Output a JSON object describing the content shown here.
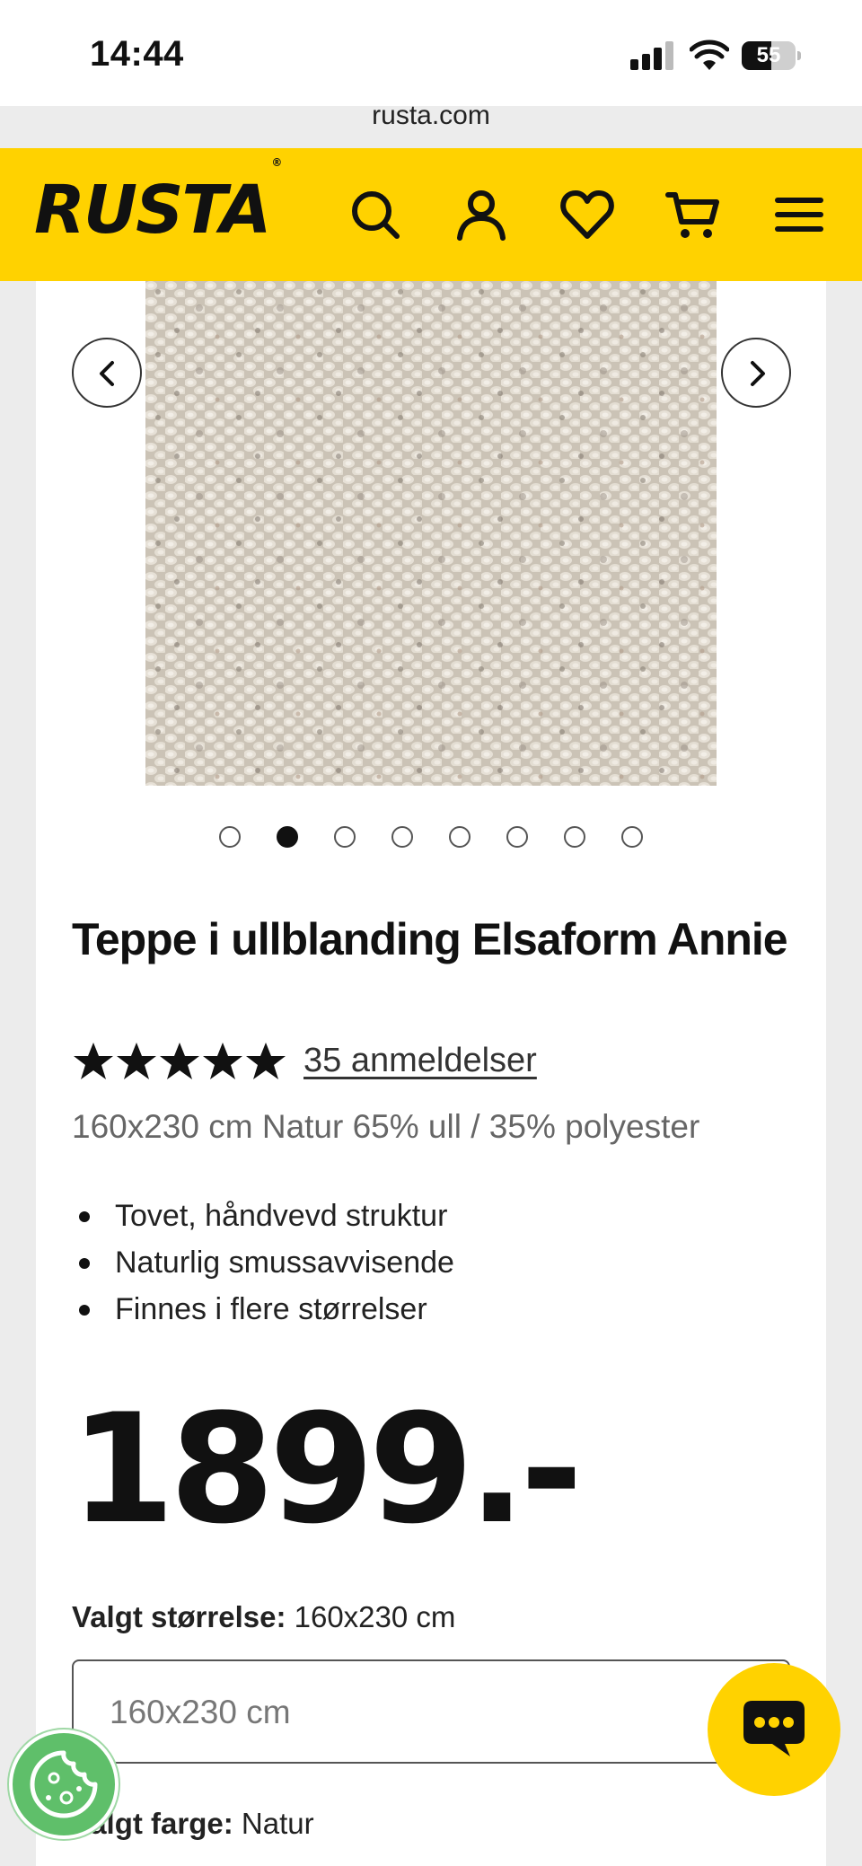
{
  "status_bar": {
    "time": "14:44",
    "battery": "55",
    "battery_level": 0.55,
    "signal_bars": 3
  },
  "browser": {
    "url": "rusta.com"
  },
  "header": {
    "logo_text": "RUSTA",
    "logo_mark": "®",
    "icons": [
      "search-icon",
      "account-icon",
      "wishlist-heart-icon",
      "cart-icon",
      "menu-icon"
    ],
    "brand_color": "#ffd200"
  },
  "gallery": {
    "image": "product-image-rug-texture",
    "total_images": 8,
    "active_index": 1
  },
  "product": {
    "title": "Teppe i ullblanding Elsaform Annie",
    "rating": 5,
    "reviews_label": "35 anmeldelser",
    "subtitle": "160x230 cm Natur 65% ull / 35% polyester",
    "features": [
      "Tovet, håndvevd struktur",
      "Naturlig smussavvisende",
      "Finnes i flere størrelser"
    ],
    "price": "1899.-"
  },
  "options": {
    "size_label": "Valgt størrelse:",
    "size_value": "160x230 cm",
    "size_select_value": "160x230 cm",
    "color_label": "Valgt farge:",
    "color_value": "Natur"
  },
  "floating": {
    "chat_icon": "chat-bubble-icon",
    "cookie_icon": "cookie-icon"
  }
}
